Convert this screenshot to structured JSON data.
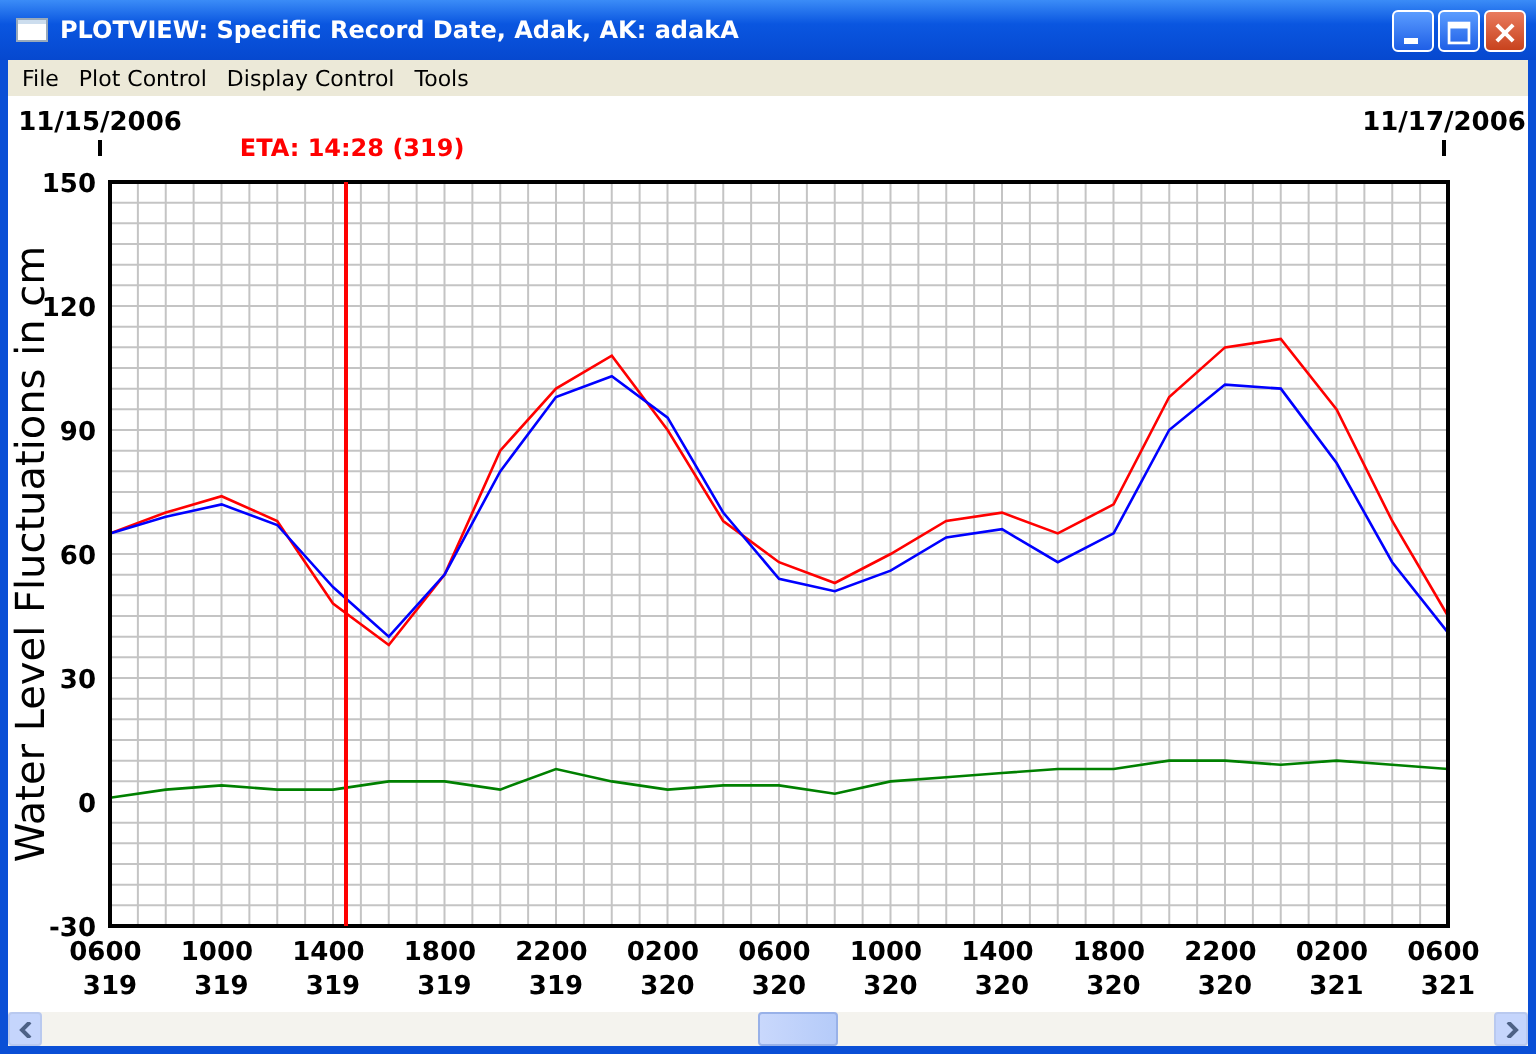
{
  "window": {
    "title": "PLOTVIEW: Specific Record Date, Adak, AK: adakA"
  },
  "menu": [
    "File",
    "Plot Control",
    "Display Control",
    "Tools"
  ],
  "plot": {
    "start_date": "11/15/2006",
    "end_date": "11/17/2006",
    "chart_data": {
      "type": "line",
      "ylabel": "Water Level Fluctuations in cm",
      "categories": [
        "0600 319",
        null,
        "1000 319",
        null,
        "1400 319",
        null,
        "1800 319",
        null,
        "2200 319",
        null,
        "0200 320",
        null,
        "0600 320",
        null,
        "1000 320",
        null,
        "1400 320",
        null,
        "1800 320",
        null,
        "2200 320",
        null,
        "0200 321",
        null,
        "0600 321"
      ],
      "series": [
        {
          "color": "#ff0000",
          "values": [
            65,
            70,
            74,
            68,
            48,
            38,
            55,
            85,
            100,
            108,
            90,
            68,
            58,
            53,
            60,
            68,
            70,
            65,
            72,
            98,
            110,
            112,
            95,
            68,
            45
          ]
        },
        {
          "color": "#0000ff",
          "values": [
            65,
            69,
            72,
            67,
            52,
            40,
            55,
            80,
            98,
            103,
            93,
            70,
            54,
            51,
            56,
            64,
            66,
            58,
            65,
            90,
            101,
            100,
            82,
            58,
            41
          ]
        },
        {
          "color": "#008000",
          "values": [
            1,
            3,
            4,
            3,
            3,
            5,
            5,
            3,
            8,
            5,
            3,
            4,
            4,
            2,
            5,
            6,
            7,
            8,
            8,
            10,
            10,
            9,
            10,
            9,
            8
          ]
        }
      ],
      "ylim": [
        -30,
        150
      ],
      "yticks": [
        -30,
        0,
        30,
        60,
        90,
        120,
        150
      ],
      "grid": true,
      "annotations": [
        "ETA: 14:28 (319)"
      ]
    }
  }
}
